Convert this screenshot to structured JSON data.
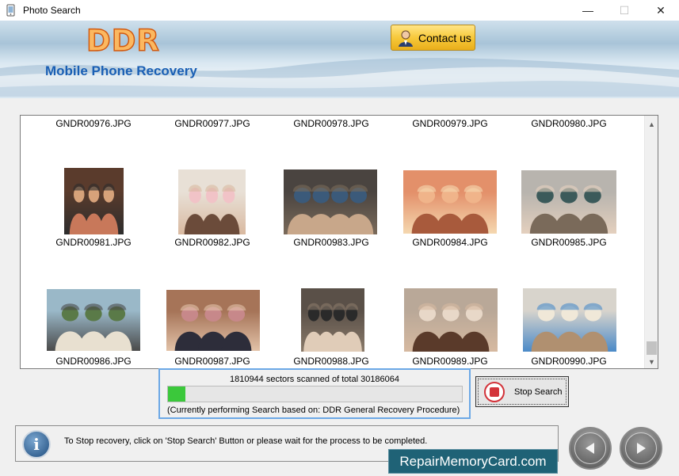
{
  "window": {
    "title": "Photo Search",
    "controls": {
      "minimize": "—",
      "maximize": "☐",
      "close": "✕"
    }
  },
  "header": {
    "logo": "DDR",
    "subtitle": "Mobile Phone Recovery",
    "contact_label": "Contact us"
  },
  "results": {
    "rows": [
      {
        "names": [
          "GNDR00976.JPG",
          "GNDR00977.JPG",
          "GNDR00978.JPG",
          "GNDR00979.JPG",
          "GNDR00980.JPG"
        ]
      },
      {
        "names": [
          "GNDR00981.JPG",
          "GNDR00982.JPG",
          "GNDR00983.JPG",
          "GNDR00984.JPG",
          "GNDR00985.JPG"
        ]
      },
      {
        "names": [
          "GNDR00986.JPG",
          "GNDR00987.JPG",
          "GNDR00988.JPG",
          "GNDR00989.JPG",
          "GNDR00990.JPG"
        ]
      }
    ]
  },
  "progress": {
    "sectors_text": "1810944 sectors scanned of total 30186064",
    "fraction": 0.06,
    "procedure_text": "(Currently performing Search based on:  DDR General Recovery Procedure)"
  },
  "stop_button": {
    "label": "Stop Search"
  },
  "status": {
    "message": "To Stop recovery, click on 'Stop Search' Button or please wait for the process to be completed."
  },
  "brand": {
    "text": "RepairMemoryCard.com"
  },
  "colors": {
    "accent": "#1a5fb4",
    "progress": "#3bc83b",
    "brand_bg": "#1f6276"
  }
}
